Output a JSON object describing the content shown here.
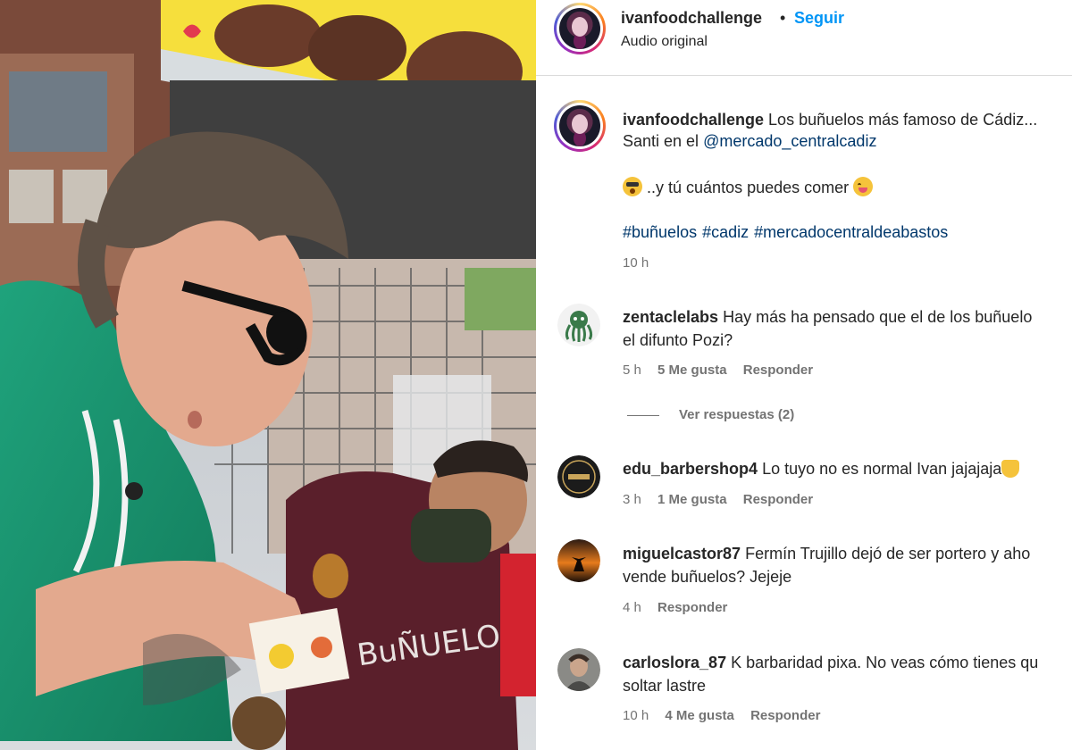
{
  "header": {
    "username": "ivanfoodchallenge",
    "separator": "•",
    "follow_label": "Seguir",
    "audio_label": "Audio original"
  },
  "caption": {
    "username": "ivanfoodchallenge",
    "text_line1": "Los buñuelos más famoso de Cádiz...",
    "text_line2_prefix": "Santi en el",
    "mention": "@mercado_centralcadiz",
    "text_line3": "..y tú cuántos puedes comer",
    "hashtags": [
      "#buñuelos",
      "#cadiz",
      "#mercadocentraldeabastos"
    ],
    "time": "10 h"
  },
  "comments": [
    {
      "username": "zentaclelabs",
      "text_line1": "Hay más ha pensado que el de los buñuelo",
      "text_line2": "el difunto Pozi?",
      "time": "5 h",
      "likes": "5 Me gusta",
      "reply_label": "Responder",
      "view_replies": "Ver respuestas (2)"
    },
    {
      "username": "edu_barbershop4",
      "text_line1": "Lo tuyo no es normal Ivan jajajaja",
      "time": "3 h",
      "likes": "1 Me gusta",
      "reply_label": "Responder"
    },
    {
      "username": "miguelcastor87",
      "text_line1": "Fermín Trujillo dejó de ser portero y aho",
      "text_line2": "vende buñuelos? Jejeje",
      "time": "4 h",
      "reply_label": "Responder"
    },
    {
      "username": "carloslora_87",
      "text_line1": "K barbaridad pixa. No veas cómo tienes qu",
      "text_line2": "soltar lastre",
      "time": "10 h",
      "likes": "4 Me gusta",
      "reply_label": "Responder"
    }
  ],
  "colors": {
    "follow_blue": "#0095f6",
    "link_blue": "#00376b",
    "meta_gray": "#737373",
    "divider": "#dbdbdb"
  }
}
